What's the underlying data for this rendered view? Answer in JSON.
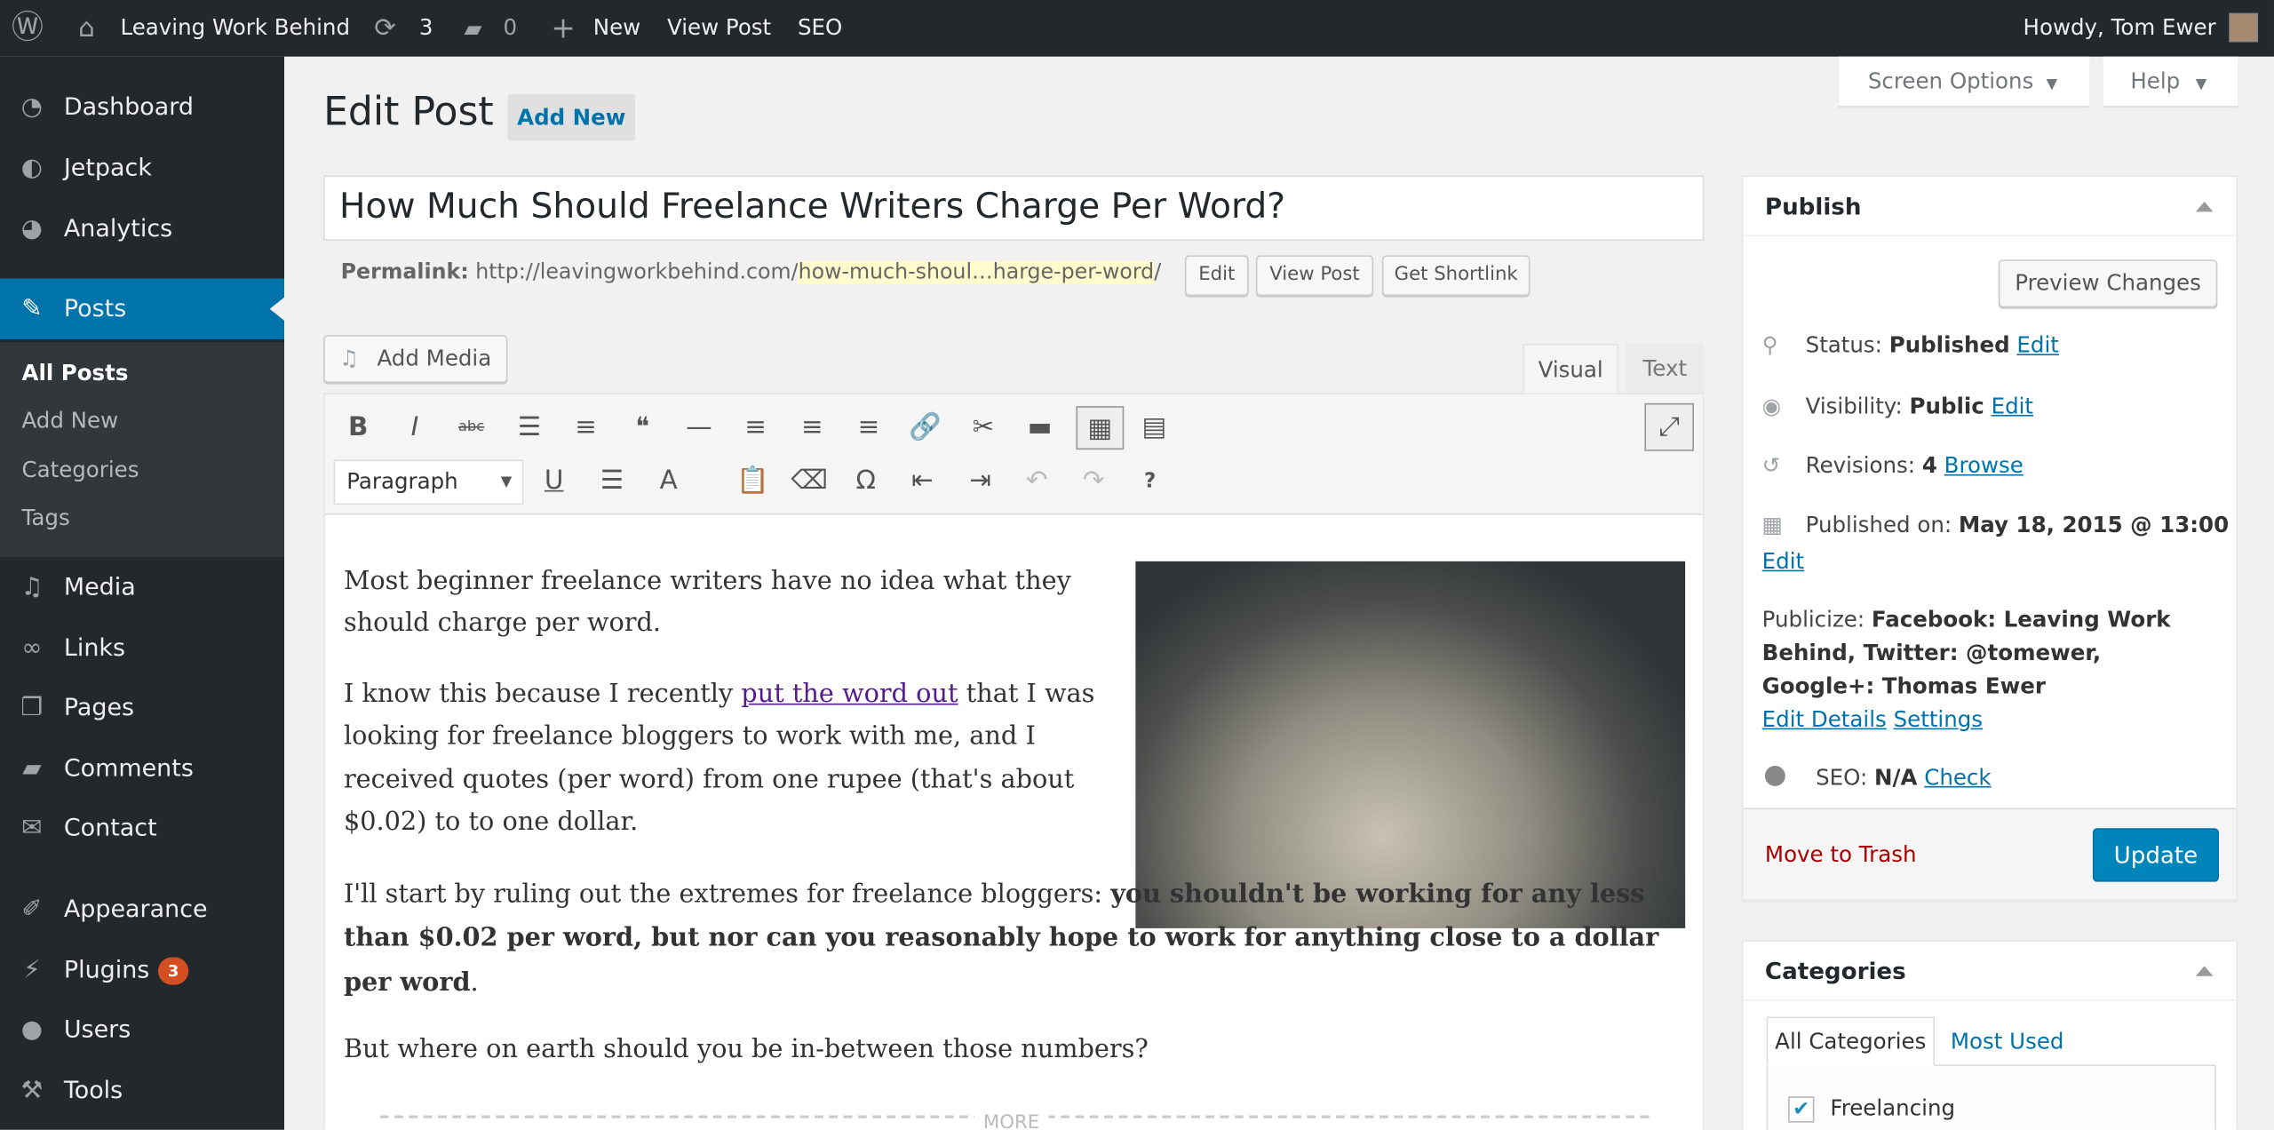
{
  "adminbar": {
    "site": "Leaving Work Behind",
    "updates": "3",
    "comments": "0",
    "new": "New",
    "view_post": "View Post",
    "seo": "SEO",
    "howdy": "Howdy, Tom Ewer"
  },
  "sidebar": {
    "items": [
      {
        "label": "Dashboard",
        "icon": "dashboard-icon"
      },
      {
        "label": "Jetpack",
        "icon": "jetpack-icon"
      },
      {
        "label": "Analytics",
        "icon": "analytics-icon"
      },
      {
        "label": "Posts",
        "icon": "pin-icon"
      },
      {
        "label": "Media",
        "icon": "media-icon"
      },
      {
        "label": "Links",
        "icon": "link-icon"
      },
      {
        "label": "Pages",
        "icon": "pages-icon"
      },
      {
        "label": "Comments",
        "icon": "comment-icon"
      },
      {
        "label": "Contact",
        "icon": "mail-icon"
      },
      {
        "label": "Appearance",
        "icon": "brush-icon"
      },
      {
        "label": "Plugins",
        "icon": "plugin-icon",
        "badge": "3"
      },
      {
        "label": "Users",
        "icon": "user-icon"
      },
      {
        "label": "Tools",
        "icon": "wrench-icon"
      }
    ],
    "submenu": [
      "All Posts",
      "Add New",
      "Categories",
      "Tags"
    ],
    "active": "Posts",
    "accent": "#0073aa"
  },
  "screen_meta": {
    "screen_options": "Screen Options",
    "help": "Help"
  },
  "page": {
    "title": "Edit Post",
    "add_new": "Add New"
  },
  "post": {
    "title": "How Much Should Freelance Writers Charge Per Word?",
    "permalink_label": "Permalink:",
    "permalink_base": "http://leavingworkbehind.com/",
    "permalink_slug": "how-much-shoul…harge-per-word",
    "permalink_trail": "/",
    "edit": "Edit",
    "view_post": "View Post",
    "get_shortlink": "Get Shortlink"
  },
  "editor": {
    "add_media": "Add Media",
    "tab_visual": "Visual",
    "tab_text": "Text",
    "format": "Paragraph",
    "more": "MORE",
    "p1": "Most beginner freelance writers have no idea what they should charge per word.",
    "p2a": "I know this because I recently ",
    "p2link": "put the word out",
    "p2b": " that I was looking for freelance bloggers to work with me, and I received quotes (per word) from one rupee (that's about $0.02) to to one dollar.",
    "p3a": "I'll start by ruling out the extremes for freelance bloggers: ",
    "p3b": "you shouldn't be working for any less than $0.02 per word, but nor can you reasonably hope to work for anything close to a dollar per word",
    "p3c": ".",
    "p4": "But where on earth should you be in-between those numbers?"
  },
  "publish": {
    "title": "Publish",
    "preview": "Preview Changes",
    "status_label": "Status:",
    "status": "Published",
    "visibility_label": "Visibility:",
    "visibility": "Public",
    "revisions_label": "Revisions:",
    "revisions": "4",
    "browse": "Browse",
    "published_label": "Published on:",
    "published": "May 18, 2015 @ 13:00",
    "edit": "Edit",
    "publicize_label": "Publicize:",
    "publicize": "Facebook: Leaving Work Behind, Twitter: @tomewer, Google+: Thomas Ewer",
    "edit_details": "Edit Details",
    "settings": "Settings",
    "seo_label": "SEO:",
    "seo": "N/A",
    "check": "Check",
    "trash": "Move to Trash",
    "update": "Update"
  },
  "categories": {
    "title": "Categories",
    "tab_all": "All Categories",
    "tab_most": "Most Used",
    "items": [
      {
        "label": "Freelancing",
        "checked": true
      }
    ]
  }
}
